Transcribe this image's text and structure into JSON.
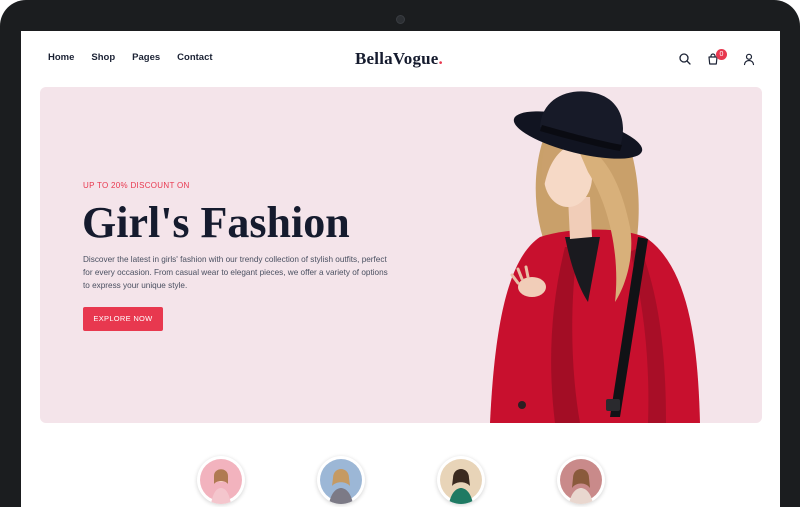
{
  "app": {
    "brand": "BellaVogue",
    "brand_dot": "."
  },
  "nav": {
    "items": [
      "Home",
      "Shop",
      "Pages",
      "Contact"
    ]
  },
  "header_icons": {
    "search": "search-icon",
    "cart": "cart-icon",
    "account": "user-icon",
    "cart_count": "0"
  },
  "hero": {
    "eyebrow": "UP TO 20% DISCOUNT ON",
    "title": "Girl's Fashion",
    "description": "Discover the latest in girls' fashion with our trendy collection of stylish outfits, perfect for every occasion. From casual wear to elegant pieces, we offer a variety of options to express your unique style.",
    "cta_label": "EXPLORE NOW"
  },
  "colors": {
    "accent": "#e8384f",
    "hero_bg": "#f4e4ea",
    "text_dark": "#151b2e"
  },
  "categories": [
    {
      "image": "category-thumbnail"
    },
    {
      "image": "category-thumbnail"
    },
    {
      "image": "category-thumbnail"
    },
    {
      "image": "category-thumbnail"
    }
  ]
}
